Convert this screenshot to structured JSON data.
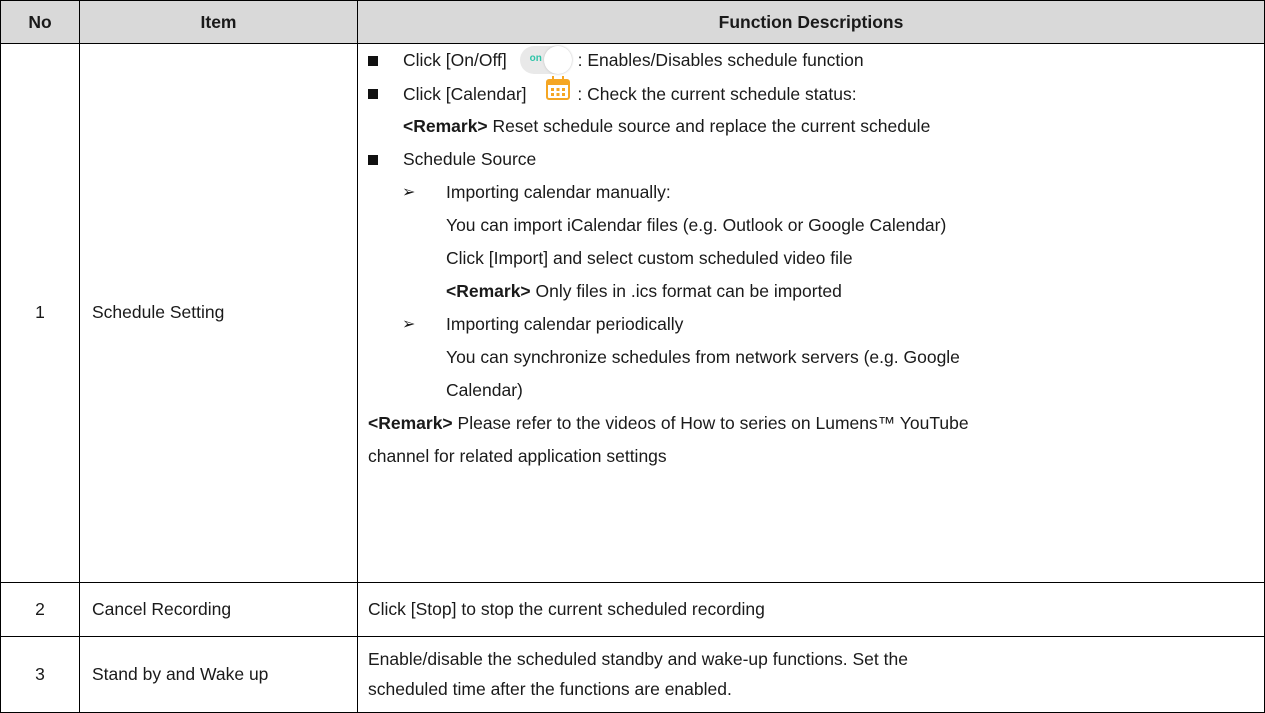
{
  "headers": {
    "no": "No",
    "item": "Item",
    "desc": "Function Descriptions"
  },
  "rows": [
    {
      "no": "1",
      "item": "Schedule Setting",
      "lines": {
        "onoff_pre": "Click [On/Off]",
        "toggle_label": "on",
        "onoff_post": ": Enables/Disables schedule function",
        "cal_pre": "Click [Calendar]",
        "cal_post": ": Check the current schedule status:",
        "remark_label": "<Remark>",
        "remark1": "Reset schedule source and replace the current schedule",
        "source": "Schedule Source",
        "manual_title": "Importing calendar manually:",
        "manual_l1": "You can import iCalendar files (e.g. Outlook or Google Calendar)",
        "manual_l2": "Click [Import] and select custom scheduled video file",
        "remark2": "Only files in .ics format can be imported",
        "periodic_title": "Importing calendar periodically",
        "periodic_l1": "You can synchronize schedules from network servers (e.g. Google",
        "periodic_l2": "Calendar)",
        "remark3_l1": "Please refer to the videos of How to series on Lumens™ YouTube",
        "remark3_l2": "channel for related application settings"
      }
    },
    {
      "no": "2",
      "item": "Cancel Recording",
      "desc": "Click [Stop] to stop the current scheduled recording"
    },
    {
      "no": "3",
      "item": "Stand by and Wake up",
      "desc_l1": "Enable/disable the scheduled standby and wake-up functions. Set the",
      "desc_l2": "scheduled time after the functions are enabled."
    }
  ],
  "icons": {
    "bullet": "square-bullet",
    "sub_bullet": "arrow-bullet",
    "toggle": "toggle-switch-icon",
    "calendar": "calendar-icon"
  },
  "colors": {
    "header_bg": "#d9d9d9",
    "toggle_accent": "#2ec4a8",
    "calendar_accent": "#f5a623"
  }
}
